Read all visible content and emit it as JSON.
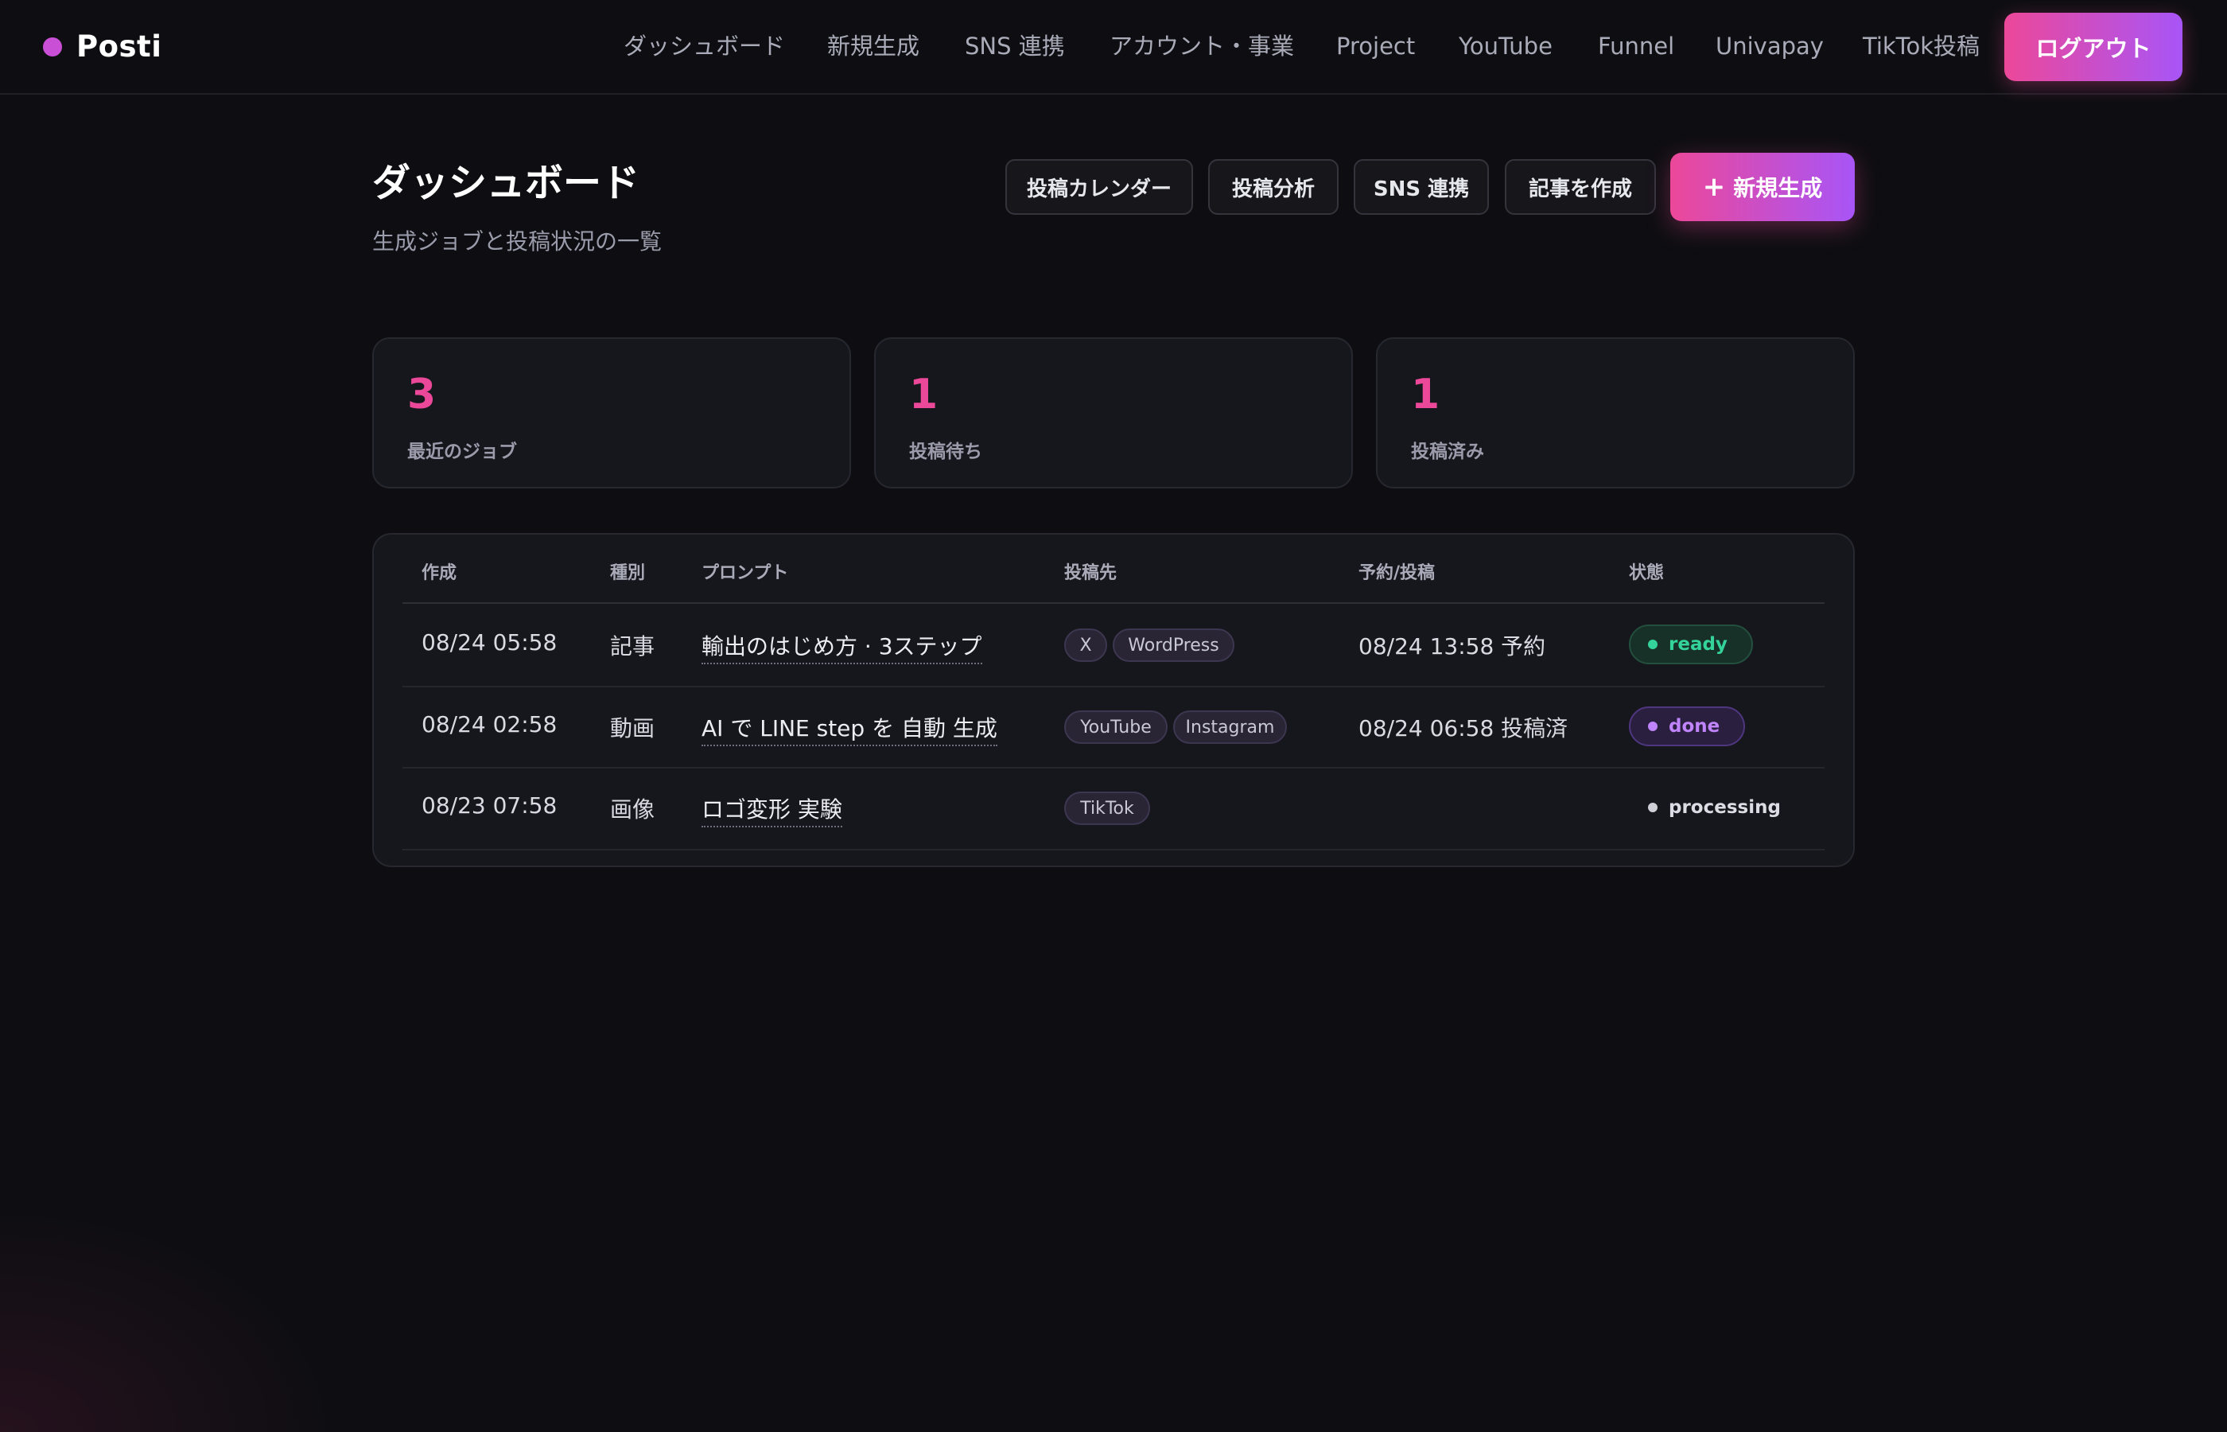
{
  "nav": {
    "brand": "Posti",
    "links": [
      "ダッシュボード",
      "新規生成",
      "SNS 連携",
      "アカウント・事業",
      "Project",
      "YouTube",
      "Funnel",
      "Univapay",
      "TikTok投稿"
    ],
    "logout_label": "ログアウト"
  },
  "header": {
    "title": "ダッシュボード",
    "subtitle": "生成ジョブと投稿状況の一覧",
    "actions": [
      "投稿カレンダー",
      "投稿分析",
      "SNS 連携",
      "記事を作成"
    ],
    "primary_action": "新規生成",
    "primary_icon": "+"
  },
  "stats": [
    {
      "value": "3",
      "label": "最近のジョブ"
    },
    {
      "value": "1",
      "label": "投稿待ち"
    },
    {
      "value": "1",
      "label": "投稿済み"
    }
  ],
  "table": {
    "columns": [
      "作成",
      "種別",
      "プロンプト",
      "投稿先",
      "予約/投稿",
      "状態"
    ],
    "rows": [
      {
        "created": "08/24 05:58",
        "type": "記事",
        "prompt": "輸出のはじめ方 · 3ステップ",
        "targets": [
          "X",
          "WordPress"
        ],
        "schedule": "08/24 13:58 予約",
        "status": "ready"
      },
      {
        "created": "08/24 02:58",
        "type": "動画",
        "prompt": "AI で LINE step を 自動 生成",
        "targets": [
          "YouTube",
          "Instagram"
        ],
        "schedule": "08/24 06:58 投稿済",
        "status": "done"
      },
      {
        "created": "08/23 07:58",
        "type": "画像",
        "prompt": "ロゴ変形 実験",
        "targets": [
          "TikTok"
        ],
        "schedule": "",
        "status": "processing"
      }
    ]
  },
  "colors": {
    "accent": "#ec4899",
    "accent_end": "#a855f7",
    "background": "#0e0e12",
    "status_ready": "#34d399",
    "status_done": "#c084fc"
  }
}
